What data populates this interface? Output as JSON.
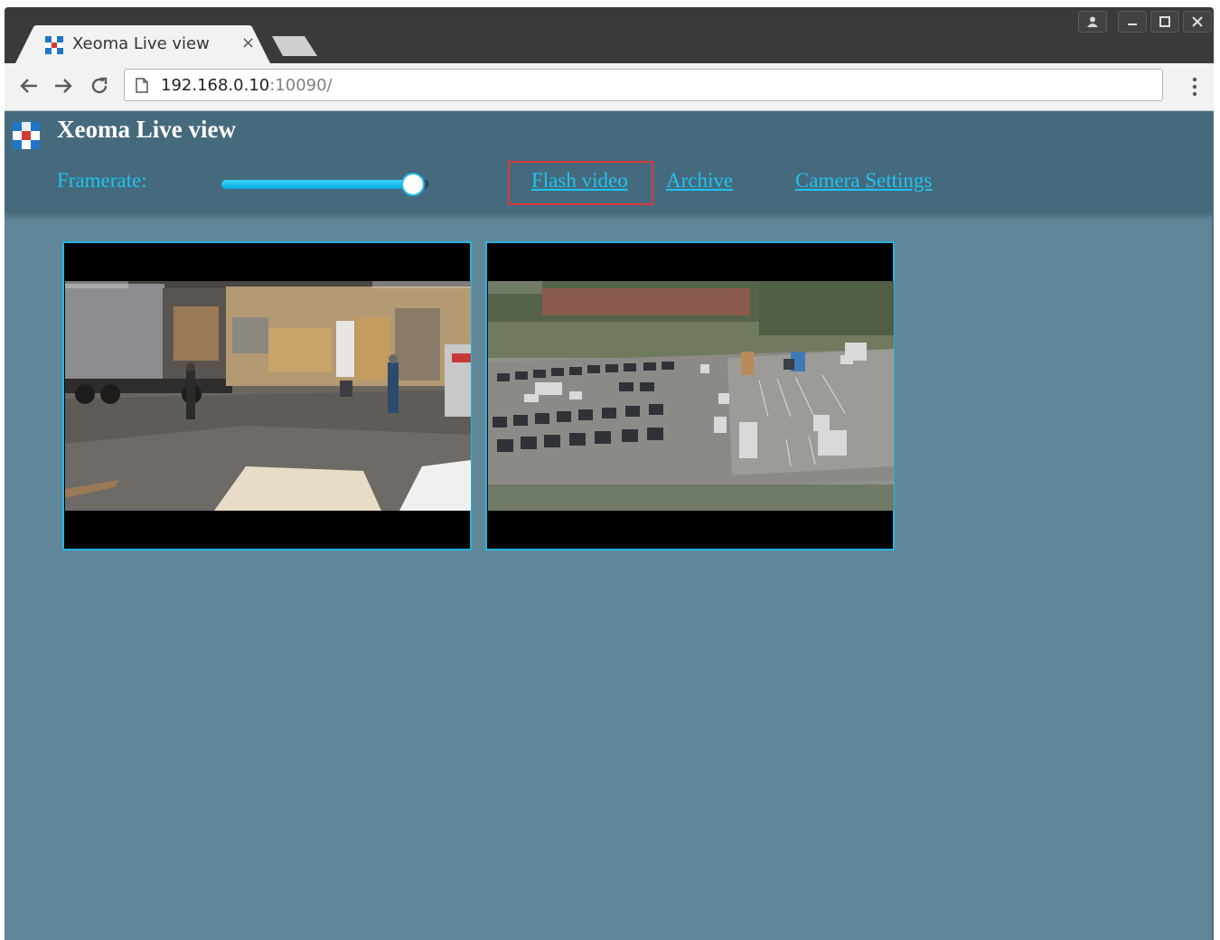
{
  "browser": {
    "tab_title": "Xeoma Live view",
    "tab_close_glyph": "×",
    "url_host": "192.168.0.10",
    "url_rest": ":10090/",
    "icons": [
      "back-icon",
      "forward-icon",
      "reload-icon",
      "page-icon",
      "menu-dots-icon",
      "user-icon",
      "minimize-icon",
      "maximize-icon",
      "close-icon"
    ]
  },
  "header": {
    "title": "Xeoma Live view",
    "framerate_label": "Framerate:",
    "framerate_level": 0.92,
    "links": [
      "Flash video",
      "Archive",
      "Camera Settings"
    ],
    "highlighted_link": "Flash video"
  },
  "cameras": [
    {
      "id": "camera-1",
      "scene": "warehouse-yard"
    },
    {
      "id": "camera-2",
      "scene": "parking-lot"
    }
  ],
  "colors": {
    "page_bg": "#5f8799",
    "header_bg": "#466a7d",
    "link": "#1dc4f0",
    "tile_border": "#27b3e0",
    "highlight": "#d53b3b"
  }
}
